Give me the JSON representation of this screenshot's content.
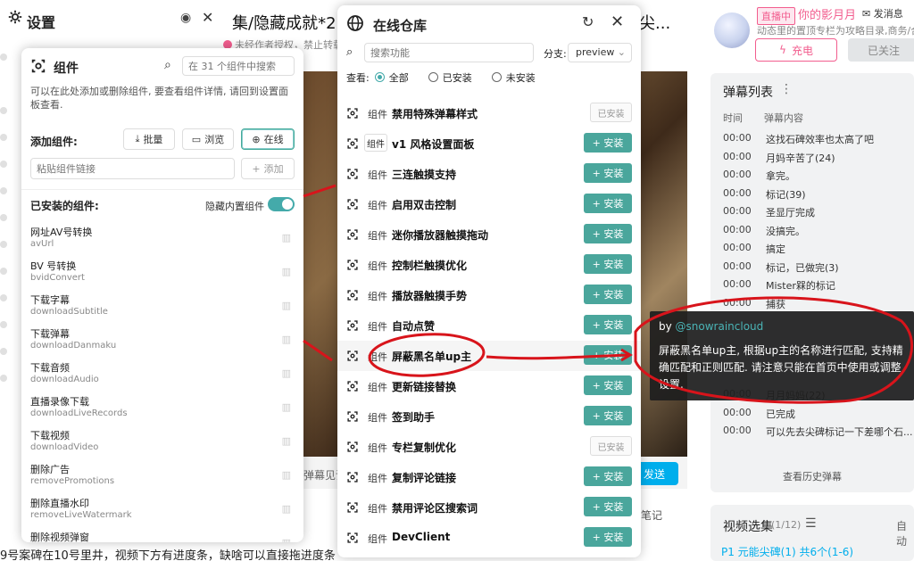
{
  "background": {
    "title": "集/隐藏成就*2:",
    "title_right": "尖...",
    "warning": "未经作者授权，禁止转载",
    "danmu_text": "弹幕见证",
    "send_label": "发送",
    "notes_label": "笔记",
    "bottom_text": "9号案碑在10号里井，视频下方有进度条，缺啥可以直接拖进度条"
  },
  "up": {
    "live_badge": "直播中",
    "name": "你的影月月",
    "message_label": "发消息",
    "desc": "动态里的置顶专栏为攻略目录,商务/合作",
    "charge_label": "充电",
    "follow_label": "已关注"
  },
  "danmu": {
    "title": "弹幕列表",
    "col_time": "时间",
    "col_content": "弹幕内容",
    "rows": [
      {
        "t": "00:00",
        "c": "这找石碑效率也太高了吧"
      },
      {
        "t": "00:00",
        "c": "月妈辛苦了(24)"
      },
      {
        "t": "00:00",
        "c": "拿完。"
      },
      {
        "t": "00:00",
        "c": "标记(39)"
      },
      {
        "t": "00:00",
        "c": "圣显厅完成"
      },
      {
        "t": "00:00",
        "c": "没搞完。"
      },
      {
        "t": "00:00",
        "c": "搞定"
      },
      {
        "t": "00:00",
        "c": "标记，已做完(3)"
      },
      {
        "t": "00:00",
        "c": "Mister槑的标记"
      },
      {
        "t": "00:00",
        "c": "捕获"
      },
      {
        "t": "",
        "c": ""
      },
      {
        "t": "",
        "c": ""
      },
      {
        "t": "",
        "c": ""
      },
      {
        "t": "",
        "c": ""
      },
      {
        "t": "00:00",
        "c": "月月妈妈(22)"
      },
      {
        "t": "00:00",
        "c": "已完成"
      },
      {
        "t": "00:00",
        "c": "可以先去尖碑标记一下差哪个石..."
      }
    ],
    "history_label": "查看历史弹幕"
  },
  "playlist": {
    "title": "视频选集",
    "count": "(1/12)",
    "auto_label": "自动",
    "item": "P1  元能尖碑(1) 共6个(1-6)"
  },
  "settings": {
    "title": "设置"
  },
  "components": {
    "title": "组件",
    "search_placeholder": "在 31 个组件中搜索",
    "desc": "可以在此处添加或删除组件, 要查看组件详情, 请回到设置面板查看.",
    "add_label": "添加组件:",
    "batch_label": "批量",
    "browse_label": "浏览",
    "online_label": "在线",
    "link_placeholder": "粘贴组件链接",
    "add_button": "添加",
    "installed_label": "已安装的组件:",
    "hide_builtin_label": "隐藏内置组件",
    "installed": [
      {
        "name": "网址AV号转换",
        "id": "avUrl"
      },
      {
        "name": "BV 号转换",
        "id": "bvidConvert"
      },
      {
        "name": "下载字幕",
        "id": "downloadSubtitle"
      },
      {
        "name": "下载弹幕",
        "id": "downloadDanmaku"
      },
      {
        "name": "下载音频",
        "id": "downloadAudio"
      },
      {
        "name": "直播录像下载",
        "id": "downloadLiveRecords"
      },
      {
        "name": "下载视频",
        "id": "downloadVideo"
      },
      {
        "name": "删除广告",
        "id": "removePromotions"
      },
      {
        "name": "删除直播水印",
        "id": "removeLiveWatermark"
      },
      {
        "name": "删除视频弹窗",
        "id": ""
      }
    ]
  },
  "store": {
    "title": "在线仓库",
    "search_placeholder": "搜索功能",
    "branch_label": "分支:",
    "branch_value": "preview",
    "filter_label": "查看:",
    "filter_all": "全部",
    "filter_installed": "已安装",
    "filter_not_installed": "未安装",
    "tag": "组件",
    "install_label": "+ 安装",
    "installed_label": "已安装",
    "items": [
      {
        "name": "禁用特殊弹幕样式",
        "state": "installed"
      },
      {
        "name": "v1 风格设置面板",
        "state": "install",
        "v1": true
      },
      {
        "name": "三连触摸支持",
        "state": "install"
      },
      {
        "name": "启用双击控制",
        "state": "install"
      },
      {
        "name": "迷你播放器触摸拖动",
        "state": "install"
      },
      {
        "name": "控制栏触摸优化",
        "state": "install"
      },
      {
        "name": "播放器触摸手势",
        "state": "install"
      },
      {
        "name": "自动点赞",
        "state": "install"
      },
      {
        "name": "屏蔽黑名单up主",
        "state": "install",
        "highlight": true
      },
      {
        "name": "更新链接替换",
        "state": "install"
      },
      {
        "name": "签到助手",
        "state": "install"
      },
      {
        "name": "专栏复制优化",
        "state": "installed"
      },
      {
        "name": "复制评论链接",
        "state": "install"
      },
      {
        "name": "禁用评论区搜索词",
        "state": "install"
      },
      {
        "name": "DevClient",
        "state": "install"
      }
    ]
  },
  "tooltip": {
    "by": "by ",
    "author": "@snowraincloud",
    "text": "屏蔽黑名单up主, 根据up主的名称进行匹配, 支持精确匹配和正则匹配. 请注意只能在首页中使用或调整设置."
  },
  "colors": {
    "accent": "#4aa69c",
    "pink": "#f25d8e",
    "annotation": "#d8141b"
  }
}
